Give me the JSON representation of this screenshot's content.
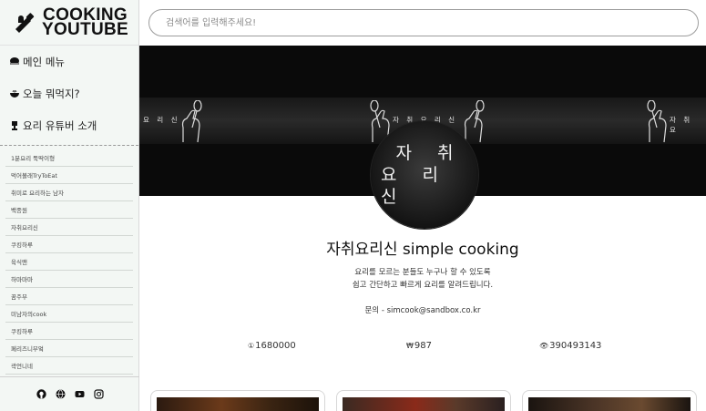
{
  "logo": {
    "line1": "COOKING",
    "line2": "YOUTUBE"
  },
  "search": {
    "placeholder": "검색어를 입력해주세요!"
  },
  "menu": [
    {
      "label": "메인 메뉴",
      "icon": "hat-icon"
    },
    {
      "label": "오늘 뭐먹지?",
      "icon": "bowl-icon"
    },
    {
      "label": "요리 유튜버 소개",
      "icon": "trophy-icon"
    }
  ],
  "youtubers": [
    "1분요리 뚝딱이형",
    "먹어볼래TryToEat",
    "취미로 요리하는 남자",
    "백종원",
    "자취요리신",
    "쿠킹하루",
    "육식맨",
    "하마마마",
    "꿈주부",
    "미남자의cook",
    "쿠킹하루",
    "페리즈니부엌",
    "곽언니네"
  ],
  "social_icons": [
    "github-icon",
    "globe-icon",
    "youtube-icon",
    "instagram-icon"
  ],
  "banner": {
    "strip_text": "요 리 신",
    "strip_text_2": "자 취 요 리 신",
    "strip_text_3": "자 취 요"
  },
  "profile": {
    "line1": "자 취",
    "line2": "요 리 신"
  },
  "channel": {
    "title": "자취요리신 simple cooking",
    "desc1": "요리를 모르는 분들도 누구나 할 수 있도록",
    "desc2": "쉽고 간단하고 빠르게 요리를 알려드립니다.",
    "contact": "문의 - simcook@sandbox.co.kr"
  },
  "stats": {
    "subscribers": "1680000",
    "videos": "987",
    "views": "390493143"
  },
  "colors": {
    "sidebar_bg": "#f3f7f4",
    "banner_bg": "#0a0a0a"
  }
}
